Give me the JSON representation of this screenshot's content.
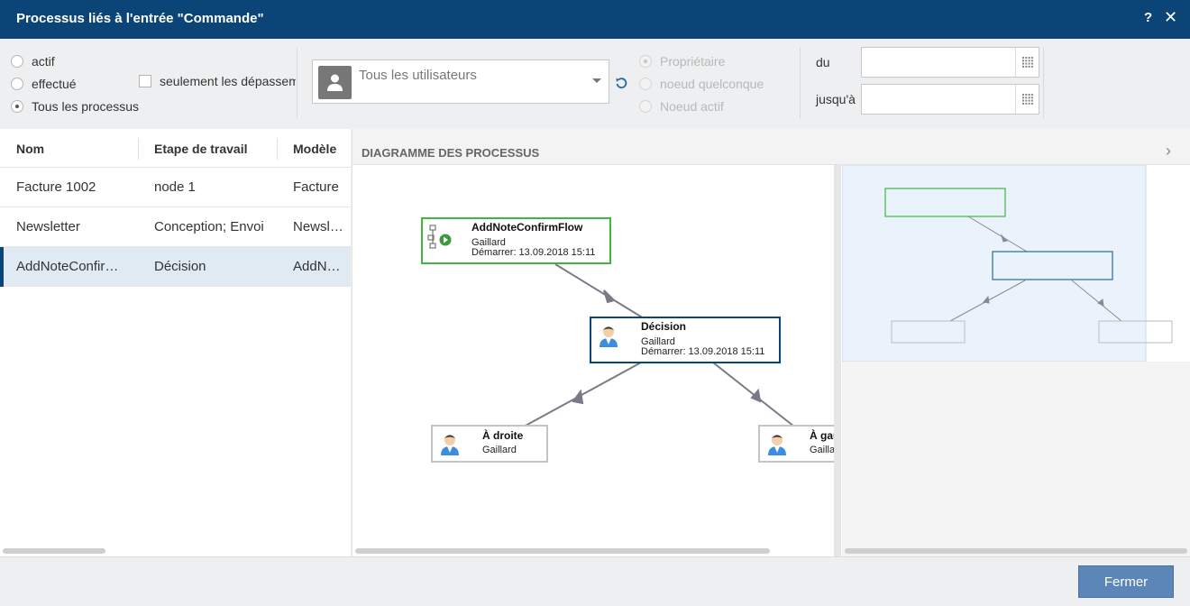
{
  "window": {
    "title": "Processus liés à l'entrée \"Commande\"",
    "help_label": "?",
    "close_label": "✕"
  },
  "filters": {
    "status_options": [
      {
        "label": "actif",
        "checked": false
      },
      {
        "label": "effectué",
        "checked": false
      },
      {
        "label": "Tous les processus",
        "checked": true
      }
    ],
    "overdue_only_label": "seulement les dépassements",
    "user_select": {
      "value": "Tous les utilisateurs"
    },
    "node_options": [
      {
        "label": "Propriétaire",
        "checked": true,
        "disabled": true
      },
      {
        "label": "noeud quelconque",
        "checked": false,
        "disabled": true
      },
      {
        "label": "Noeud actif",
        "checked": false,
        "disabled": true
      }
    ],
    "date_from_label": "du",
    "date_to_label": "jusqu'à",
    "date_from_value": "",
    "date_to_value": ""
  },
  "list": {
    "columns": [
      "Nom",
      "Etape de travail",
      "Modèle"
    ],
    "rows": [
      {
        "name": "Facture 1002",
        "step": "node 1",
        "model": "Facture"
      },
      {
        "name": "Newsletter",
        "step": "Conception; Envoi",
        "model": "Newsletter"
      },
      {
        "name": "AddNoteConfirmFlow",
        "step": "Décision",
        "model": "AddNoteConfirmFlow"
      }
    ],
    "selected_index": 2
  },
  "diagram": {
    "title": "DIAGRAMME DES PROCESSUS",
    "nodes": {
      "start": {
        "title": "AddNoteConfirmFlow",
        "user": "Gaillard",
        "date": "Démarrer: 13.09.2018 15:11"
      },
      "decision": {
        "title": "Décision",
        "user": "Gaillard",
        "date": "Démarrer: 13.09.2018 15:11"
      },
      "left": {
        "title": "À droite",
        "user": "Gaillard"
      },
      "right": {
        "title": "À gauche",
        "user": "Gaillard"
      }
    },
    "colors": {
      "start_border": "#3cb93c",
      "active_border": "#0b4577",
      "pending_border": "#c4c4c4",
      "edge": "#7a7a86",
      "overview_viewport": "#eaf3fb"
    }
  },
  "footer": {
    "close_button": "Fermer"
  },
  "colors": {
    "titlebar": "#0b4577",
    "primary_button": "#5c86b8",
    "selected_row": "#dfeaf3"
  }
}
